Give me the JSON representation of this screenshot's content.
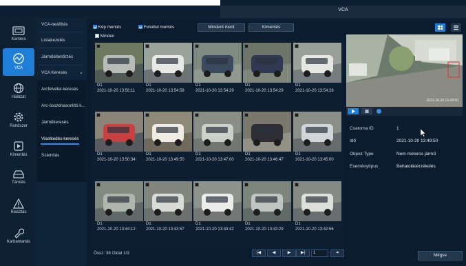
{
  "window": {
    "title": "VCA"
  },
  "nav": [
    {
      "label": "Kamera",
      "icon": "camera-icon"
    },
    {
      "label": "VCA",
      "icon": "vca-icon",
      "active": true
    },
    {
      "label": "Hálózat",
      "icon": "globe-icon"
    },
    {
      "label": "Rendszer",
      "icon": "gear-icon"
    },
    {
      "label": "Kimentés",
      "icon": "export-icon"
    },
    {
      "label": "Tárolás",
      "icon": "storage-icon"
    },
    {
      "label": "Riasztás",
      "icon": "warning-icon"
    },
    {
      "label": "Karbantartás",
      "icon": "wrench-icon"
    }
  ],
  "submenu": {
    "items": [
      "VCA-beállítás",
      "Listakezelés",
      "Járműellenőrzés",
      "VCA Keresés"
    ],
    "sub_items": [
      "Arcfelvétel-keresés",
      "Arc-összehasonlító k...",
      "Járműkeresés",
      "Viselkedés-keresés",
      "Számítás"
    ],
    "active": "Viselkedés-keresés"
  },
  "toolbar": {
    "kep_mentes": "Kép mentés",
    "felvetel_mentes": "Felvétel mentés",
    "mindent_ment": "Mindent ment",
    "kimentes": "Kimentés",
    "minden": "Minden"
  },
  "thumbnails": [
    {
      "channel": "D1",
      "time": "2021-10-20 13:56:11"
    },
    {
      "channel": "D1",
      "time": "2021-10-20 13:54:58"
    },
    {
      "channel": "D1",
      "time": "2021-10-20 13:54:29"
    },
    {
      "channel": "D1",
      "time": "2021-10-20 13:54:29"
    },
    {
      "channel": "D1",
      "time": "2021-10-20 13:54:28"
    },
    {
      "channel": "D1",
      "time": "2021-10-20 13:50:34"
    },
    {
      "channel": "D1",
      "time": "2021-10-20 13:49:50"
    },
    {
      "channel": "D1",
      "time": "2021-10-20 13:47:00"
    },
    {
      "channel": "D1",
      "time": "2021-10-20 13:46:47"
    },
    {
      "channel": "D1",
      "time": "2021-10-20 13:45:00"
    },
    {
      "channel": "D1",
      "time": "2021-10-20 13:44:12"
    },
    {
      "channel": "D1",
      "time": "2021-10-20 13:43:57"
    },
    {
      "channel": "D1",
      "time": "2021-10-20 13:43:42"
    },
    {
      "channel": "D1",
      "time": "2021-10-20 13:43:29"
    },
    {
      "channel": "D1",
      "time": "2021-10-20 13:42:56"
    }
  ],
  "preview": {
    "timestamp": "2021-10-20 13:49:50"
  },
  "details": [
    {
      "label": "Csatorna ID",
      "value": "1"
    },
    {
      "label": "Idő",
      "value": "2021-10-20 13:49:50"
    },
    {
      "label": "Object Type",
      "value": "Nem motoros jármű"
    },
    {
      "label": "Eseménytípus",
      "value": "Behatolásérzékelés"
    }
  ],
  "footer": {
    "total": "Össz: 38  Oldal 1/3",
    "page_value": "1",
    "back_label": "Mégse"
  },
  "colors": {
    "accent": "#1f7fd8",
    "background": "#0b1c2e"
  }
}
